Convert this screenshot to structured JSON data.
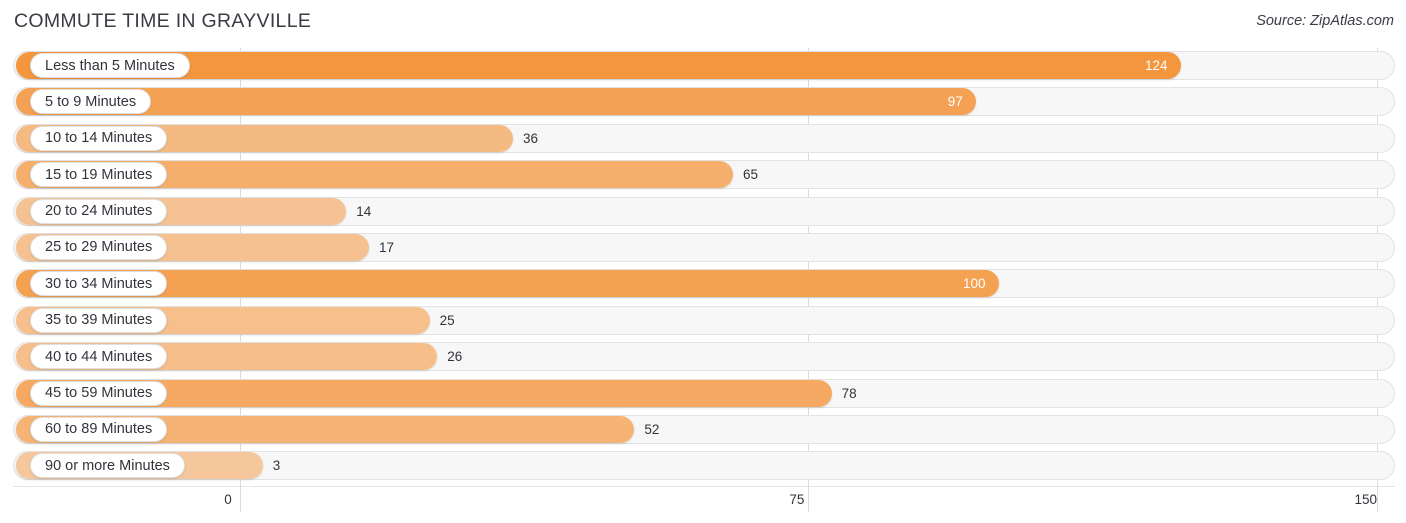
{
  "header": {
    "title": "COMMUTE TIME IN GRAYVILLE",
    "source": "Source: ZipAtlas.com"
  },
  "chart_data": {
    "type": "bar",
    "orientation": "horizontal",
    "title": "COMMUTE TIME IN GRAYVILLE",
    "xlabel": "",
    "ylabel": "",
    "xlim": [
      0,
      150
    ],
    "ticks": [
      "0",
      "75",
      "150"
    ],
    "tick_values": [
      0,
      75,
      150
    ],
    "grid": true,
    "legend": "none",
    "accent_color": "#f5a353",
    "track_color": "#f7f7f7",
    "categories": [
      "Less than 5 Minutes",
      "5 to 9 Minutes",
      "10 to 14 Minutes",
      "15 to 19 Minutes",
      "20 to 24 Minutes",
      "25 to 29 Minutes",
      "30 to 34 Minutes",
      "35 to 39 Minutes",
      "40 to 44 Minutes",
      "45 to 59 Minutes",
      "60 to 89 Minutes",
      "90 or more Minutes"
    ],
    "values": [
      124,
      97,
      36,
      65,
      14,
      17,
      100,
      25,
      26,
      78,
      52,
      3
    ],
    "value_labels": [
      "124",
      "97",
      "36",
      "65",
      "14",
      "17",
      "100",
      "25",
      "26",
      "78",
      "52",
      "3"
    ]
  },
  "rows": [
    {
      "label": "Less than 5 Minutes",
      "value": 124,
      "value_label": "124",
      "inside": true
    },
    {
      "label": "5 to 9 Minutes",
      "value": 97,
      "value_label": "97",
      "inside": true
    },
    {
      "label": "10 to 14 Minutes",
      "value": 36,
      "value_label": "36",
      "inside": false
    },
    {
      "label": "15 to 19 Minutes",
      "value": 65,
      "value_label": "65",
      "inside": false
    },
    {
      "label": "20 to 24 Minutes",
      "value": 14,
      "value_label": "14",
      "inside": false
    },
    {
      "label": "25 to 29 Minutes",
      "value": 17,
      "value_label": "17",
      "inside": false
    },
    {
      "label": "30 to 34 Minutes",
      "value": 100,
      "value_label": "100",
      "inside": true
    },
    {
      "label": "35 to 39 Minutes",
      "value": 25,
      "value_label": "25",
      "inside": false
    },
    {
      "label": "40 to 44 Minutes",
      "value": 26,
      "value_label": "26",
      "inside": false
    },
    {
      "label": "45 to 59 Minutes",
      "value": 78,
      "value_label": "78",
      "inside": false
    },
    {
      "label": "60 to 89 Minutes",
      "value": 52,
      "value_label": "52",
      "inside": false
    },
    {
      "label": "90 or more Minutes",
      "value": 3,
      "value_label": "3",
      "inside": false
    }
  ]
}
